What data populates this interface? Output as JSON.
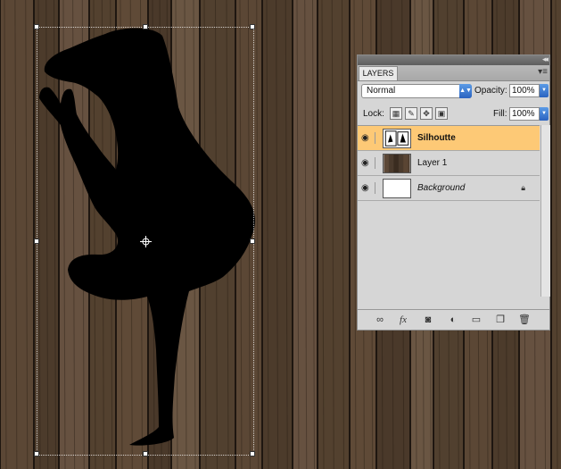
{
  "canvas": {
    "wood_base": "#4a3a2c",
    "silhouette_color": "#000000"
  },
  "layers_panel": {
    "tab_label": "LAYERS",
    "collapse_glyph": "◂◂",
    "menu_glyph": "▾≡",
    "blend_mode": "Normal",
    "opacity_label": "Opacity:",
    "opacity_value": "100%",
    "lock_label": "Lock:",
    "fill_label": "Fill:",
    "fill_value": "100%",
    "layers": [
      {
        "name": "Silhoutte",
        "selected": true,
        "bold": true,
        "italic": false,
        "visible": true
      },
      {
        "name": "Layer 1",
        "selected": false,
        "bold": false,
        "italic": false,
        "visible": true
      },
      {
        "name": "Background",
        "selected": false,
        "bold": false,
        "italic": true,
        "visible": true,
        "locked": true
      }
    ],
    "accent_selected": "#fdc976",
    "footer_icons": [
      "link-icon",
      "fx-icon",
      "mask-icon",
      "adjustment-icon",
      "folder-icon",
      "new-layer-icon",
      "trash-icon"
    ]
  }
}
